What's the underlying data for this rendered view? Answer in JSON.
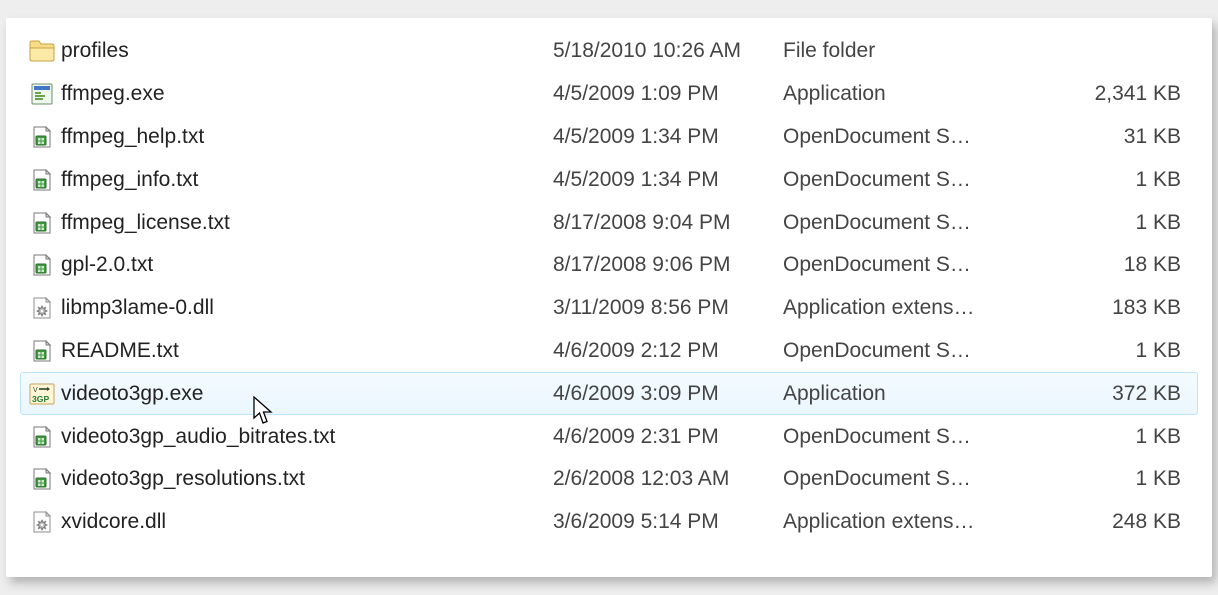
{
  "files": [
    {
      "icon": "folder",
      "name": "profiles",
      "date": "5/18/2010 10:26 AM",
      "type": "File folder",
      "size": "",
      "selected": false
    },
    {
      "icon": "app",
      "name": "ffmpeg.exe",
      "date": "4/5/2009 1:09 PM",
      "type": "Application",
      "size": "2,341 KB",
      "selected": false
    },
    {
      "icon": "odt",
      "name": "ffmpeg_help.txt",
      "date": "4/5/2009 1:34 PM",
      "type": "OpenDocument S…",
      "size": "31 KB",
      "selected": false
    },
    {
      "icon": "odt",
      "name": "ffmpeg_info.txt",
      "date": "4/5/2009 1:34 PM",
      "type": "OpenDocument S…",
      "size": "1 KB",
      "selected": false
    },
    {
      "icon": "odt",
      "name": "ffmpeg_license.txt",
      "date": "8/17/2008 9:04 PM",
      "type": "OpenDocument S…",
      "size": "1 KB",
      "selected": false
    },
    {
      "icon": "odt",
      "name": "gpl-2.0.txt",
      "date": "8/17/2008 9:06 PM",
      "type": "OpenDocument S…",
      "size": "18 KB",
      "selected": false
    },
    {
      "icon": "dll",
      "name": "libmp3lame-0.dll",
      "date": "3/11/2009 8:56 PM",
      "type": "Application extens…",
      "size": "183 KB",
      "selected": false
    },
    {
      "icon": "odt",
      "name": "README.txt",
      "date": "4/6/2009 2:12 PM",
      "type": "OpenDocument S…",
      "size": "1 KB",
      "selected": false
    },
    {
      "icon": "3gp",
      "name": "videoto3gp.exe",
      "date": "4/6/2009 3:09 PM",
      "type": "Application",
      "size": "372 KB",
      "selected": true
    },
    {
      "icon": "odt",
      "name": "videoto3gp_audio_bitrates.txt",
      "date": "4/6/2009 2:31 PM",
      "type": "OpenDocument S…",
      "size": "1 KB",
      "selected": false
    },
    {
      "icon": "odt",
      "name": "videoto3gp_resolutions.txt",
      "date": "2/6/2008 12:03 AM",
      "type": "OpenDocument S…",
      "size": "1 KB",
      "selected": false
    },
    {
      "icon": "dll",
      "name": "xvidcore.dll",
      "date": "3/6/2009 5:14 PM",
      "type": "Application extens…",
      "size": "248 KB",
      "selected": false
    }
  ]
}
